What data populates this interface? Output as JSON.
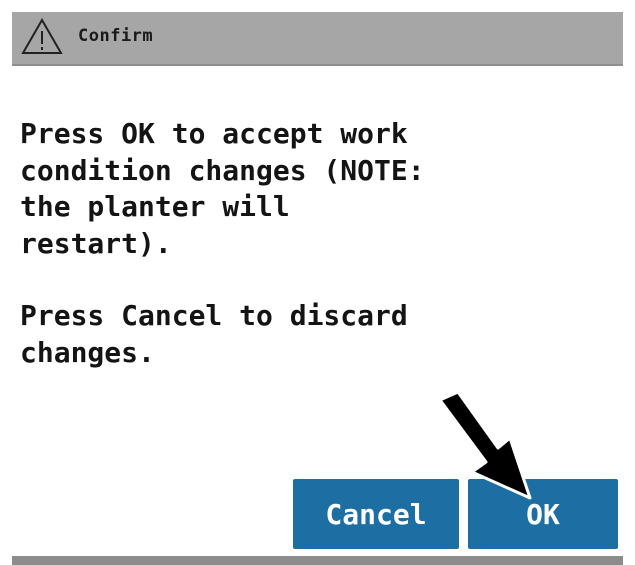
{
  "dialog": {
    "title": "Confirm",
    "title_icon": "warning-icon",
    "message_lines_1": "Press OK to accept work\ncondition changes (NOTE:\nthe planter will\nrestart).",
    "message_lines_2": "Press Cancel to discard\nchanges.",
    "buttons": {
      "cancel_label": "Cancel",
      "ok_label": "OK"
    }
  },
  "annotation": {
    "pointer_icon": "arrow-pointer-icon",
    "target": "ok-button"
  },
  "colors": {
    "titlebar": "#a6a6a6",
    "button": "#1d6fa3",
    "button_text": "#ffffff",
    "text": "#141414"
  }
}
